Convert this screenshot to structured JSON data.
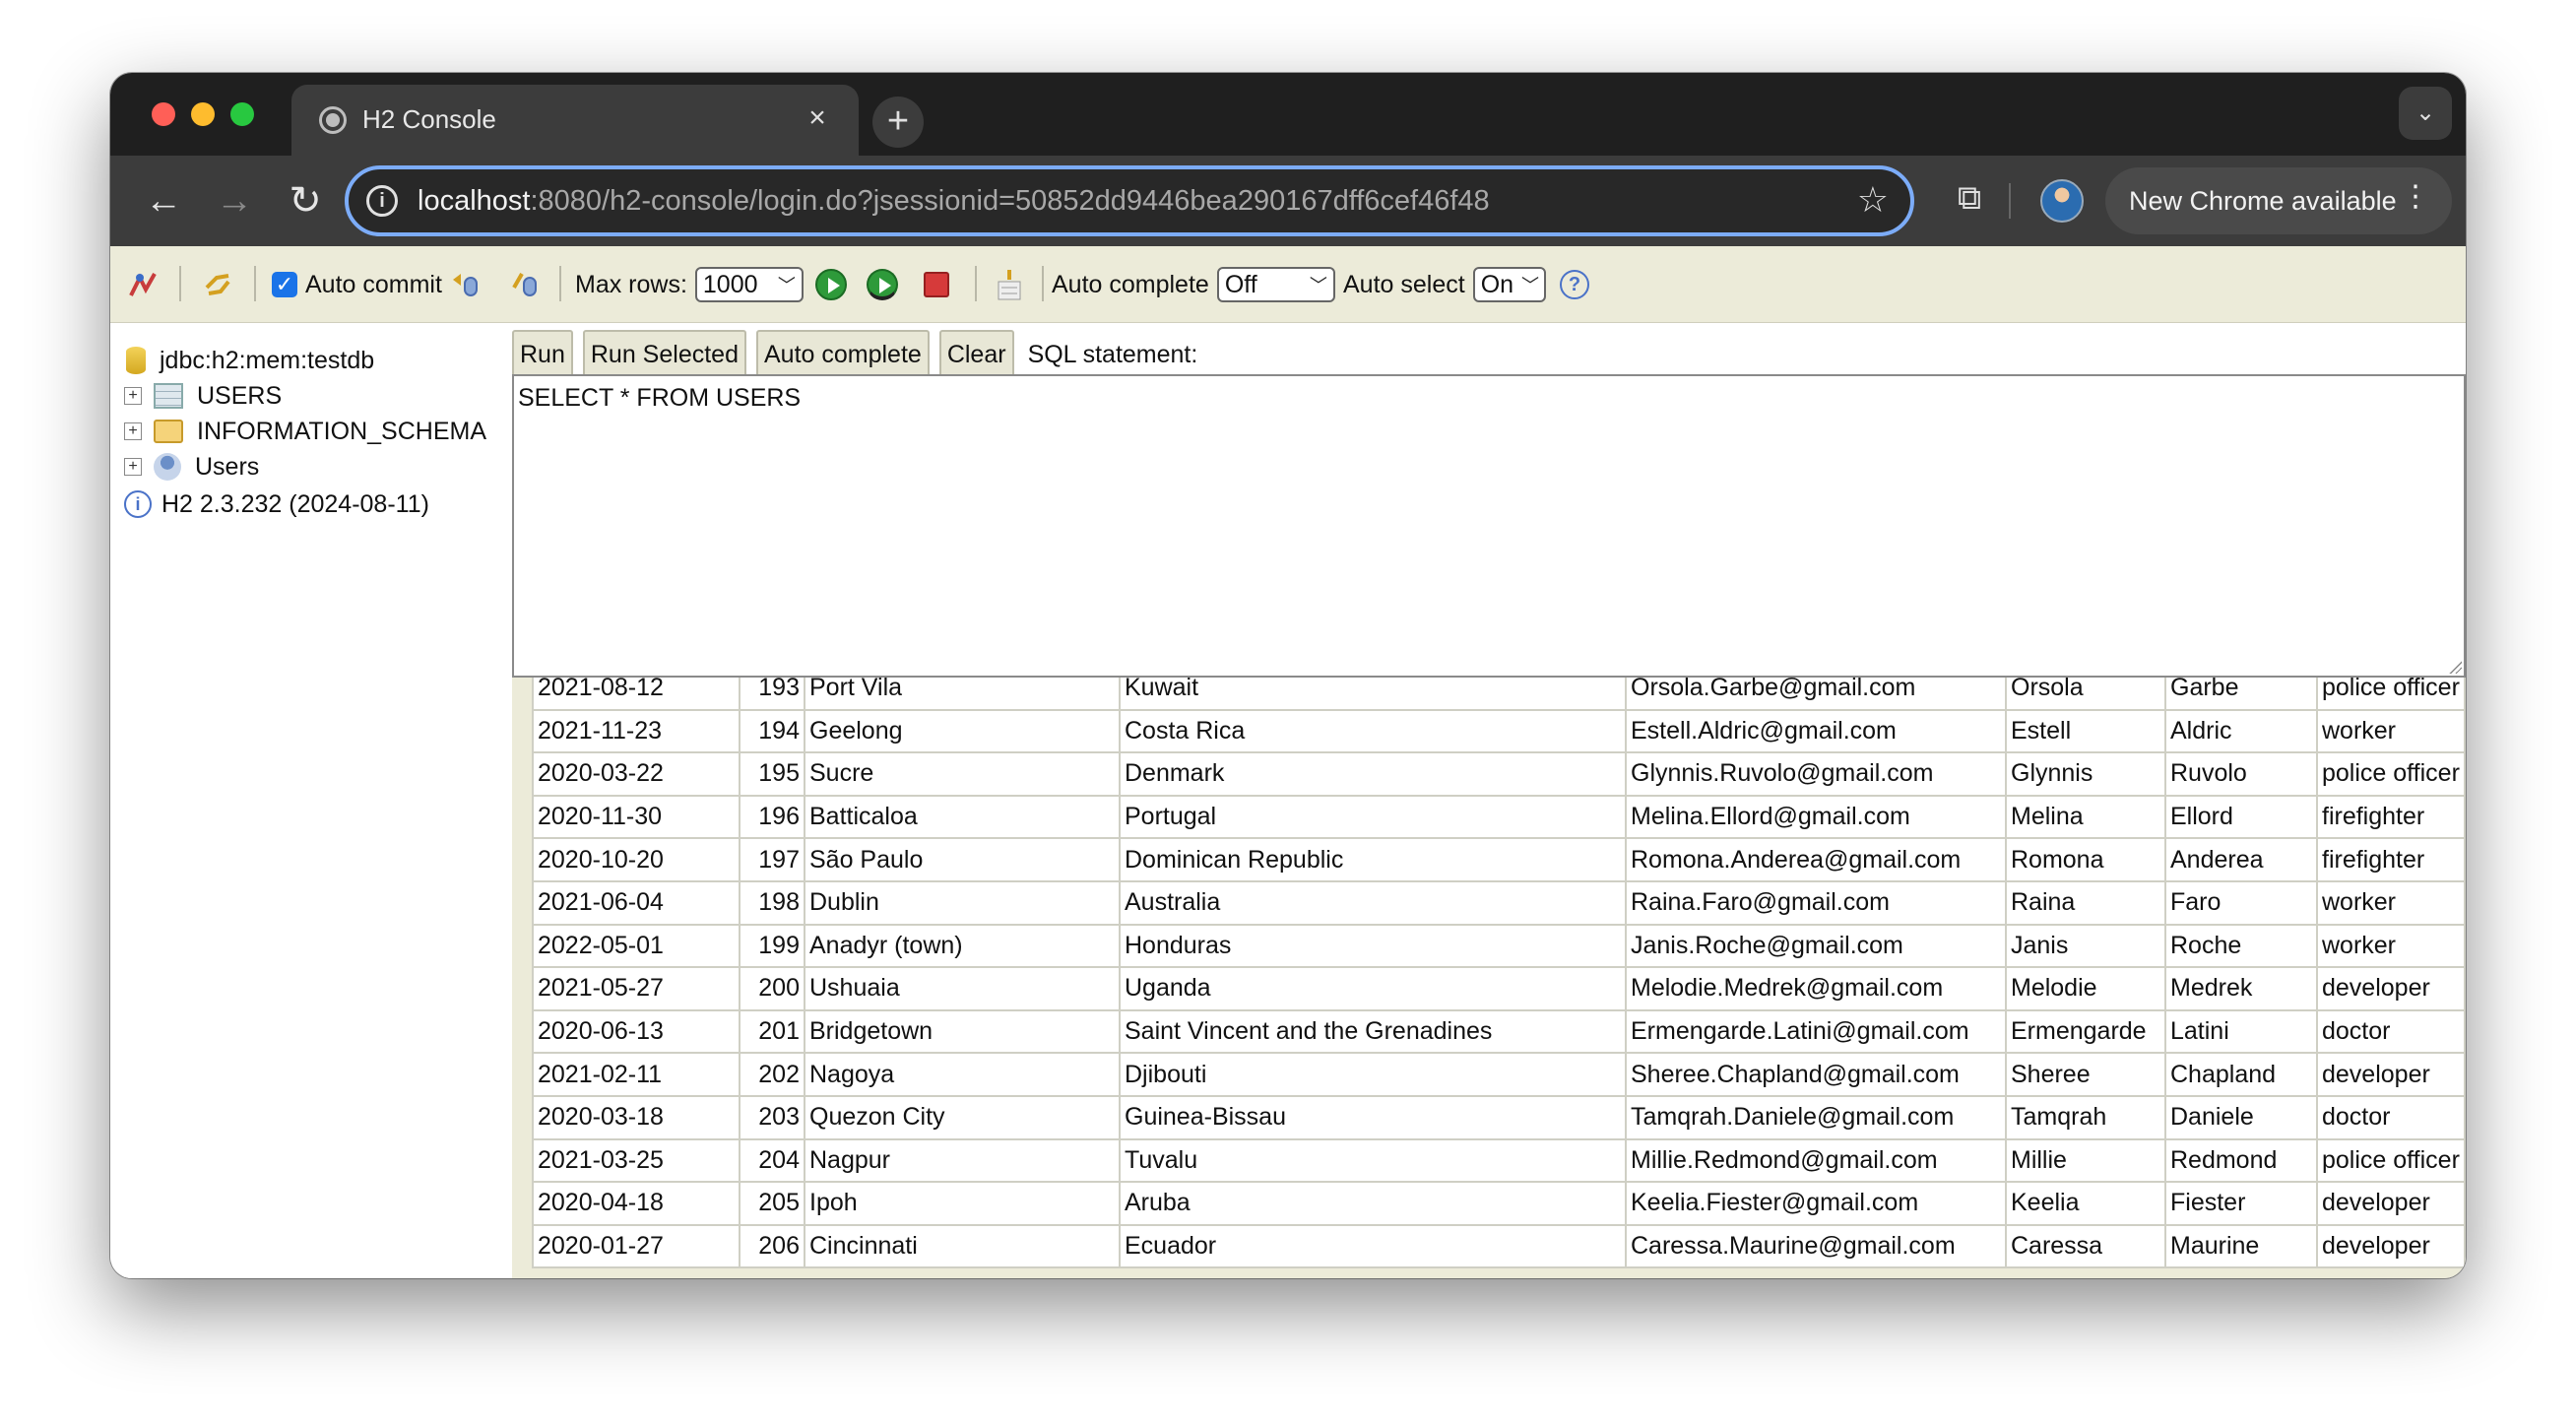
{
  "browser": {
    "tab_title": "H2 Console",
    "tab_close": "×",
    "new_tab": "+",
    "tab_menu": "⌄",
    "url_host": "localhost",
    "url_rest": ":8080/h2-console/login.do?jsessionid=50852dd9446bea290167dff6cef46f48",
    "update_label": "New Chrome available",
    "update_menu": "⋮",
    "back": "←",
    "forward": "→",
    "reload": "↻",
    "star": "☆",
    "info": "i",
    "extensions": "⧉"
  },
  "h2_toolbar": {
    "auto_commit_label": "Auto commit",
    "auto_commit_checked": "✓",
    "max_rows_label": "Max rows:",
    "max_rows_value": "1000",
    "auto_complete_label": "Auto complete",
    "auto_complete_value": "Off",
    "auto_select_label": "Auto select",
    "auto_select_value": "On",
    "help": "?"
  },
  "tree": {
    "connection": "jdbc:h2:mem:testdb",
    "items": [
      {
        "label": "USERS",
        "expander": "+"
      },
      {
        "label": "INFORMATION_SCHEMA",
        "expander": "+"
      },
      {
        "label": "Users",
        "expander": "+"
      }
    ],
    "version": "H2 2.3.232 (2024-08-11)",
    "version_icon": "i"
  },
  "sql_buttons": {
    "run": "Run",
    "run_selected": "Run Selected",
    "auto_complete": "Auto complete",
    "clear": "Clear",
    "statement_label": "SQL statement:"
  },
  "sql_text": "SELECT * FROM USERS",
  "results": {
    "rows": [
      [
        "2021-08-12",
        "193",
        "Port Vila",
        "Kuwait",
        "Orsola.Garbe@gmail.com",
        "Orsola",
        "Garbe",
        "police officer"
      ],
      [
        "2021-11-23",
        "194",
        "Geelong",
        "Costa Rica",
        "Estell.Aldric@gmail.com",
        "Estell",
        "Aldric",
        "worker"
      ],
      [
        "2020-03-22",
        "195",
        "Sucre",
        "Denmark",
        "Glynnis.Ruvolo@gmail.com",
        "Glynnis",
        "Ruvolo",
        "police officer"
      ],
      [
        "2020-11-30",
        "196",
        "Batticaloa",
        "Portugal",
        "Melina.Ellord@gmail.com",
        "Melina",
        "Ellord",
        "firefighter"
      ],
      [
        "2020-10-20",
        "197",
        "São Paulo",
        "Dominican Republic",
        "Romona.Anderea@gmail.com",
        "Romona",
        "Anderea",
        "firefighter"
      ],
      [
        "2021-06-04",
        "198",
        "Dublin",
        "Australia",
        "Raina.Faro@gmail.com",
        "Raina",
        "Faro",
        "worker"
      ],
      [
        "2022-05-01",
        "199",
        "Anadyr (town)",
        "Honduras",
        "Janis.Roche@gmail.com",
        "Janis",
        "Roche",
        "worker"
      ],
      [
        "2021-05-27",
        "200",
        "Ushuaia",
        "Uganda",
        "Melodie.Medrek@gmail.com",
        "Melodie",
        "Medrek",
        "developer"
      ],
      [
        "2020-06-13",
        "201",
        "Bridgetown",
        "Saint Vincent and the Grenadines",
        "Ermengarde.Latini@gmail.com",
        "Ermengarde",
        "Latini",
        "doctor"
      ],
      [
        "2021-02-11",
        "202",
        "Nagoya",
        "Djibouti",
        "Sheree.Chapland@gmail.com",
        "Sheree",
        "Chapland",
        "developer"
      ],
      [
        "2020-03-18",
        "203",
        "Quezon City",
        "Guinea-Bissau",
        "Tamqrah.Daniele@gmail.com",
        "Tamqrah",
        "Daniele",
        "doctor"
      ],
      [
        "2021-03-25",
        "204",
        "Nagpur",
        "Tuvalu",
        "Millie.Redmond@gmail.com",
        "Millie",
        "Redmond",
        "police officer"
      ],
      [
        "2020-04-18",
        "205",
        "Ipoh",
        "Aruba",
        "Keelia.Fiester@gmail.com",
        "Keelia",
        "Fiester",
        "developer"
      ],
      [
        "2020-01-27",
        "206",
        "Cincinnati",
        "Ecuador",
        "Caressa.Maurine@gmail.com",
        "Caressa",
        "Maurine",
        "developer"
      ]
    ]
  },
  "colors": {
    "h2_toolbar_bg": "#ecebd9",
    "omnibox_focus": "#7cacf8",
    "chrome_frame": "#1f1f1f",
    "chrome_toolbar": "#3c3c3c"
  }
}
